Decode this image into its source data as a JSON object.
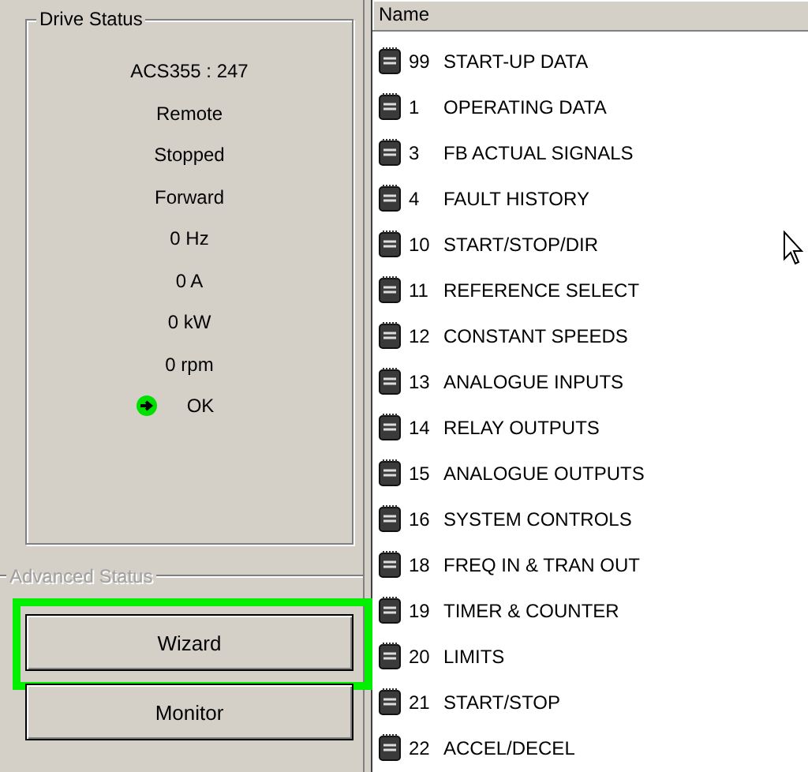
{
  "drive_status": {
    "title": "Drive Status",
    "lines": [
      "ACS355 : 247",
      "Remote",
      "Stopped",
      "Forward",
      "0 Hz",
      "0 A",
      "0 kW",
      "0 rpm"
    ],
    "status": {
      "text": "OK",
      "color": "#00e000"
    }
  },
  "advanced_status": {
    "title": "Advanced Status",
    "disabled": true
  },
  "buttons": [
    {
      "label": "Wizard",
      "highlighted": true
    },
    {
      "label": "Monitor",
      "highlighted": false
    }
  ],
  "list": {
    "column": "Name",
    "items": [
      {
        "number": "99",
        "name": "START-UP DATA"
      },
      {
        "number": "1",
        "name": "OPERATING DATA"
      },
      {
        "number": "3",
        "name": "FB ACTUAL SIGNALS"
      },
      {
        "number": "4",
        "name": "FAULT HISTORY"
      },
      {
        "number": "10",
        "name": "START/STOP/DIR"
      },
      {
        "number": "11",
        "name": "REFERENCE SELECT"
      },
      {
        "number": "12",
        "name": "CONSTANT SPEEDS"
      },
      {
        "number": "13",
        "name": "ANALOGUE INPUTS"
      },
      {
        "number": "14",
        "name": "RELAY OUTPUTS"
      },
      {
        "number": "15",
        "name": "ANALOGUE OUTPUTS"
      },
      {
        "number": "16",
        "name": "SYSTEM CONTROLS"
      },
      {
        "number": "18",
        "name": "FREQ IN & TRAN OUT"
      },
      {
        "number": "19",
        "name": "TIMER & COUNTER"
      },
      {
        "number": "20",
        "name": "LIMITS"
      },
      {
        "number": "21",
        "name": "START/STOP"
      },
      {
        "number": "22",
        "name": "ACCEL/DECEL"
      }
    ]
  }
}
